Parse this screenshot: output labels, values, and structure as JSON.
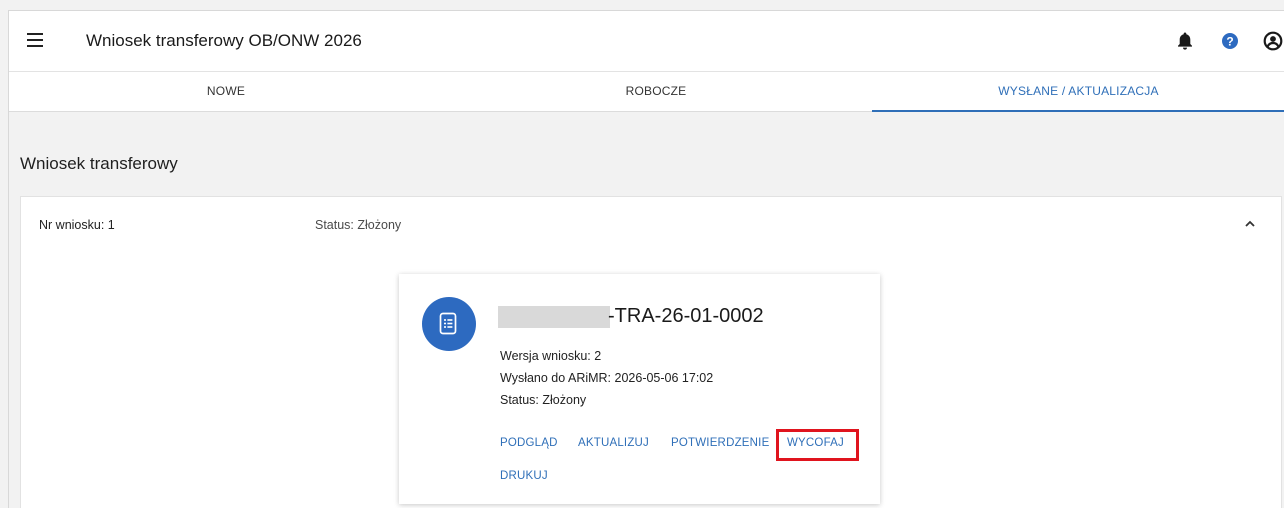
{
  "app": {
    "title": "Wniosek transferowy OB/ONW 2026"
  },
  "tabs": [
    {
      "label": "NOWE",
      "active": false
    },
    {
      "label": "ROBOCZE",
      "active": false
    },
    {
      "label": "WYSŁANE / AKTUALIZACJA",
      "active": true
    }
  ],
  "section": {
    "title": "Wniosek transferowy"
  },
  "panel": {
    "nr_label": "Nr wniosku: 1",
    "status_label": "Status: Złożony"
  },
  "card": {
    "doc_id_suffix": "-TRA-26-01-0002",
    "version": "Wersja wniosku: 2",
    "sent": "Wysłano do ARiMR: 2026-05-06 17:02",
    "status": "Status: Złożony",
    "actions": [
      "PODGLĄD",
      "AKTUALIZUJ",
      "POTWIERDZENIE",
      "WYCOFAJ",
      "DRUKUJ"
    ],
    "highlighted_action": "WYCOFAJ"
  },
  "icons": {
    "menu": "hamburger-menu-icon",
    "notifications": "bell-icon",
    "help": "help-icon",
    "account": "account-icon",
    "collapse": "chevron-up-icon",
    "document": "document-list-icon"
  },
  "colors": {
    "accent": "#2f6fb8",
    "document_circle": "#2d6ac0",
    "highlight": "#e0141e",
    "background": "#f2f2f2"
  }
}
